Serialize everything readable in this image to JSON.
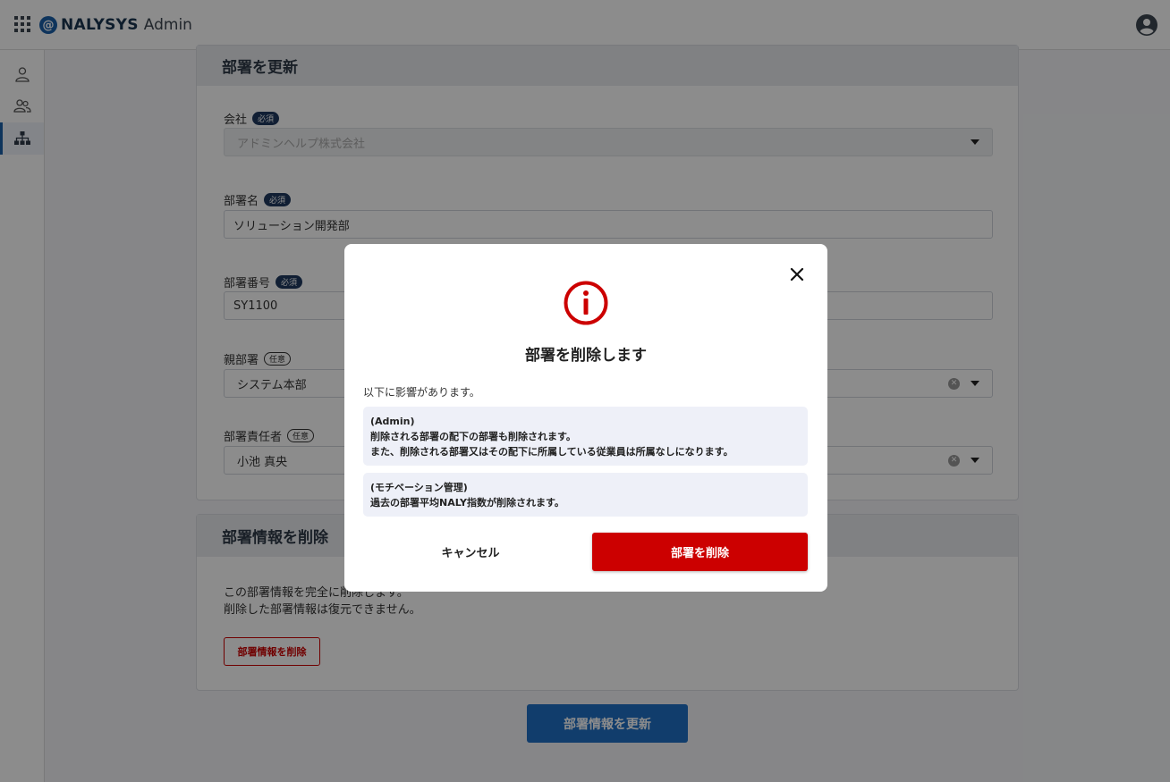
{
  "header": {
    "logo_mark": "@",
    "brand": "NALYSYS",
    "brand_suffix": "Admin",
    "icons": [
      "apps-grid-icon",
      "account-circle-icon"
    ]
  },
  "sidebar": {
    "items": [
      {
        "name": "user-icon",
        "active": false
      },
      {
        "name": "users-icon",
        "active": false
      },
      {
        "name": "org-chart-icon",
        "active": true
      }
    ]
  },
  "form": {
    "title": "部署を更新",
    "company": {
      "label": "会社",
      "badge": "必須",
      "value": "アドミンヘルプ株式会社"
    },
    "dept_name": {
      "label": "部署名",
      "badge": "必須",
      "value": "ソリューション開発部"
    },
    "dept_number": {
      "label": "部署番号",
      "badge": "必須",
      "value": "SY1100"
    },
    "parent_dept": {
      "label": "親部署",
      "badge": "任意",
      "value": "システム本部"
    },
    "manager": {
      "label": "部署責任者",
      "badge": "任意",
      "value": "小池 真央"
    }
  },
  "delete_section": {
    "title": "部署情報を削除",
    "note_line1": "この部署情報を完全に削除します。",
    "note_line2": "削除した部署情報は復元できません。",
    "button": "部署情報を削除"
  },
  "update_button": "部署情報を更新",
  "modal": {
    "title": "部署を削除します",
    "lead": "以下に影響があります。",
    "admin_heading": "(Admin)",
    "admin_line1": "削除される部署の配下の部署も削除されます。",
    "admin_line2": "また、削除される部署又はその配下に所属している従業員は所属なしになります。",
    "motivation_heading": "(モチベーション管理)",
    "motivation_line1": "過去の部署平均NALY指数が削除されます。",
    "cancel": "キャンセル",
    "confirm": "部署を削除",
    "accent_color": "#cc0000"
  }
}
